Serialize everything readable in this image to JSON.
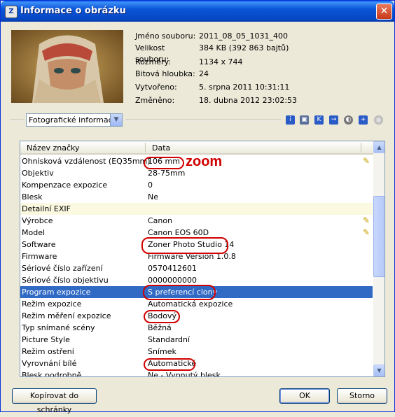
{
  "window": {
    "title": "Informace o obrázku",
    "icon": "app-icon"
  },
  "file_info": [
    {
      "label": "Jméno souboru:",
      "value": "2011_08_05_1031_400"
    },
    {
      "label": "Velikost souboru:",
      "value": "384 KB (392 863 bajtů)"
    },
    {
      "label": "Rozměry:",
      "value": "1134 x 744"
    },
    {
      "label": "Bitová hloubka:",
      "value": "24"
    },
    {
      "label": "Vytvořeno:",
      "value": "5. srpna 2011 10:31:11"
    },
    {
      "label": "Změněno:",
      "value": "18. dubna 2012 23:02:53"
    }
  ],
  "dropdown": {
    "selected": "Fotografické informace"
  },
  "toolbar_icons": [
    "info-icon",
    "camera-icon",
    "k-icon",
    "arrow-icon",
    "gps-icon",
    "add-icon",
    "circle-icon"
  ],
  "list": {
    "headers": {
      "name": "Název značky",
      "data": "Data"
    },
    "rows": [
      {
        "name": "Ohnisková vzdálenost (EQ35mm)",
        "value": "106 mm",
        "editable": true
      },
      {
        "name": "Objektiv",
        "value": "28-75mm"
      },
      {
        "name": "Kompenzace expozice",
        "value": "0"
      },
      {
        "name": "Blesk",
        "value": "Ne"
      },
      {
        "name": "Detailní EXIF",
        "value": "",
        "section": true
      },
      {
        "name": "Výrobce",
        "value": "Canon",
        "editable": true
      },
      {
        "name": "Model",
        "value": "Canon EOS 60D",
        "editable": true
      },
      {
        "name": "Software",
        "value": "Zoner Photo Studio 14"
      },
      {
        "name": "Firmware",
        "value": "Firmware Version 1.0.8"
      },
      {
        "name": "Sériové číslo zařízení",
        "value": "0570412601"
      },
      {
        "name": "Sériové číslo objektivu",
        "value": "0000000000"
      },
      {
        "name": "Program expozice",
        "value": "S preferencí clony",
        "selected": true
      },
      {
        "name": "Režim expozice",
        "value": "Automatická expozice"
      },
      {
        "name": "Režim měření expozice",
        "value": "Bodový"
      },
      {
        "name": "Typ snímané scény",
        "value": "Běžná"
      },
      {
        "name": "Picture Style",
        "value": "Standardní"
      },
      {
        "name": "Režim ostření",
        "value": "Snímek"
      },
      {
        "name": "Vyrovnání bílé",
        "value": "Automatické"
      },
      {
        "name": "Blesk podrobně",
        "value": "Ne - Vypnutý blesk"
      }
    ]
  },
  "annotation": {
    "zoom_label": "zoom"
  },
  "buttons": {
    "copy": "Kopírovat do schránky",
    "ok": "OK",
    "cancel": "Storno"
  },
  "colors": {
    "annotation": "#d10000",
    "selection": "#316ac5",
    "titlebar": "#0a55d8"
  }
}
